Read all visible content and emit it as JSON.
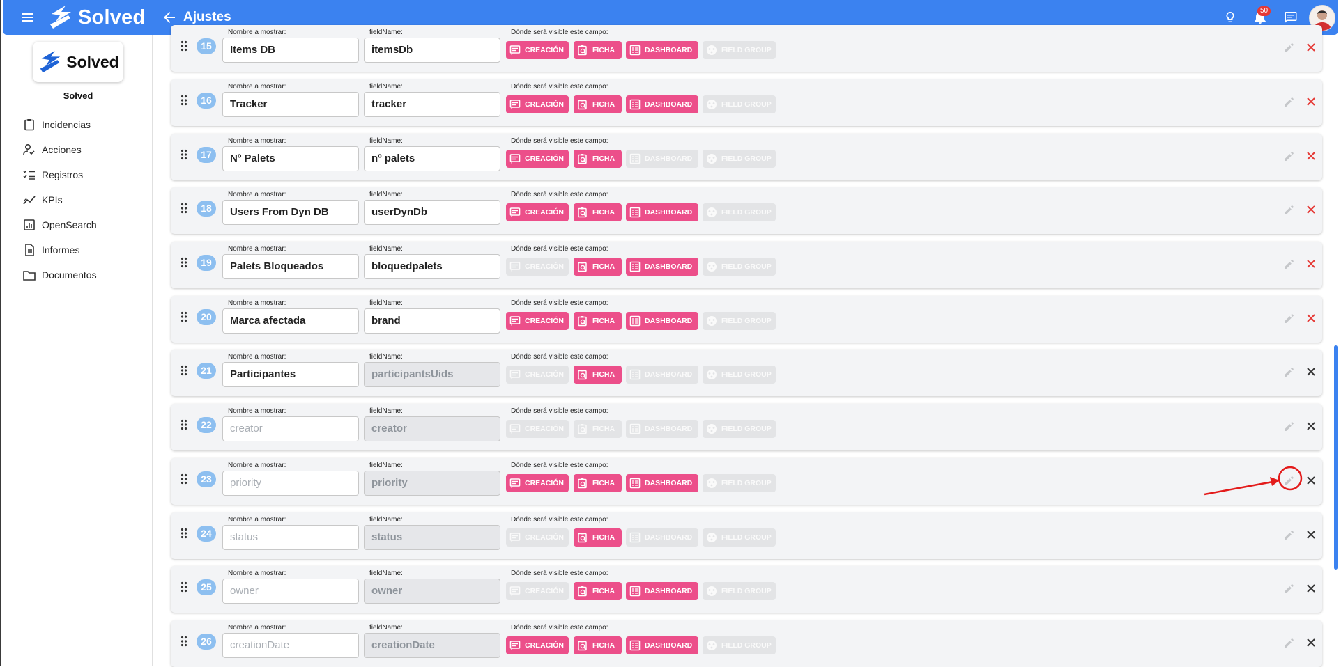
{
  "header": {
    "app_name": "Solved",
    "page_title": "Ajustes",
    "notification_count": "50",
    "accent_color": "#3b82f0"
  },
  "sidebar": {
    "brand_name": "Solved",
    "items": [
      {
        "label": "Incidencias",
        "icon": "clipboard-icon"
      },
      {
        "label": "Acciones",
        "icon": "user-check-icon"
      },
      {
        "label": "Registros",
        "icon": "checklist-icon"
      },
      {
        "label": "KPIs",
        "icon": "trend-chart-icon"
      },
      {
        "label": "OpenSearch",
        "icon": "analytics-icon"
      },
      {
        "label": "Informes",
        "icon": "document-icon"
      },
      {
        "label": "Documentos",
        "icon": "folder-icon"
      }
    ]
  },
  "labels": {
    "display_name": "Nombre a mostrar:",
    "field_name": "fieldName:",
    "visibility": "Dónde será visible este campo:",
    "chip_creation": "CREACIÓN",
    "chip_ficha": "FICHA",
    "chip_dashboard": "DASHBOARD",
    "chip_fieldgroup": "FIELD GROUP"
  },
  "colors": {
    "chip_active": "#ec4f8a",
    "chip_inactive": "#e3e4e6",
    "number_badge": "#8dbff0",
    "delete_active": "#e53935",
    "annotation": "#e31b1b"
  },
  "fields": [
    {
      "number": "15",
      "display_name": "Items DB",
      "display_is_placeholder": false,
      "field_name": "itemsDb",
      "field_disabled": false,
      "creation": true,
      "ficha": true,
      "dashboard": true,
      "field_group": false,
      "delete_red": true
    },
    {
      "number": "16",
      "display_name": "Tracker",
      "display_is_placeholder": false,
      "field_name": "tracker",
      "field_disabled": false,
      "creation": true,
      "ficha": true,
      "dashboard": true,
      "field_group": false,
      "delete_red": true
    },
    {
      "number": "17",
      "display_name": "Nº Palets",
      "display_is_placeholder": false,
      "field_name": "nº palets",
      "field_disabled": false,
      "creation": true,
      "ficha": true,
      "dashboard": false,
      "field_group": false,
      "delete_red": true
    },
    {
      "number": "18",
      "display_name": "Users From Dyn DB",
      "display_is_placeholder": false,
      "field_name": "userDynDb",
      "field_disabled": false,
      "creation": true,
      "ficha": true,
      "dashboard": true,
      "field_group": false,
      "delete_red": true
    },
    {
      "number": "19",
      "display_name": "Palets Bloqueados",
      "display_is_placeholder": false,
      "field_name": "bloquedpalets",
      "field_disabled": false,
      "creation": false,
      "ficha": true,
      "dashboard": true,
      "field_group": false,
      "delete_red": true
    },
    {
      "number": "20",
      "display_name": "Marca afectada",
      "display_is_placeholder": false,
      "field_name": "brand",
      "field_disabled": false,
      "creation": true,
      "ficha": true,
      "dashboard": true,
      "field_group": false,
      "delete_red": true
    },
    {
      "number": "21",
      "display_name": "Participantes",
      "display_is_placeholder": false,
      "field_name": "participantsUids",
      "field_disabled": true,
      "creation": false,
      "ficha": true,
      "dashboard": false,
      "field_group": false,
      "delete_red": false
    },
    {
      "number": "22",
      "display_name": "creator",
      "display_is_placeholder": true,
      "field_name": "creator",
      "field_disabled": true,
      "creation": false,
      "ficha": false,
      "dashboard": false,
      "field_group": false,
      "delete_red": false
    },
    {
      "number": "23",
      "display_name": "priority",
      "display_is_placeholder": true,
      "field_name": "priority",
      "field_disabled": true,
      "creation": true,
      "ficha": true,
      "dashboard": true,
      "field_group": false,
      "delete_red": false
    },
    {
      "number": "24",
      "display_name": "status",
      "display_is_placeholder": true,
      "field_name": "status",
      "field_disabled": true,
      "creation": false,
      "ficha": true,
      "dashboard": false,
      "field_group": false,
      "delete_red": false
    },
    {
      "number": "25",
      "display_name": "owner",
      "display_is_placeholder": true,
      "field_name": "owner",
      "field_disabled": true,
      "creation": false,
      "ficha": true,
      "dashboard": true,
      "field_group": false,
      "delete_red": false
    },
    {
      "number": "26",
      "display_name": "creationDate",
      "display_is_placeholder": true,
      "field_name": "creationDate",
      "field_disabled": true,
      "creation": true,
      "ficha": true,
      "dashboard": true,
      "field_group": false,
      "delete_red": false
    }
  ]
}
